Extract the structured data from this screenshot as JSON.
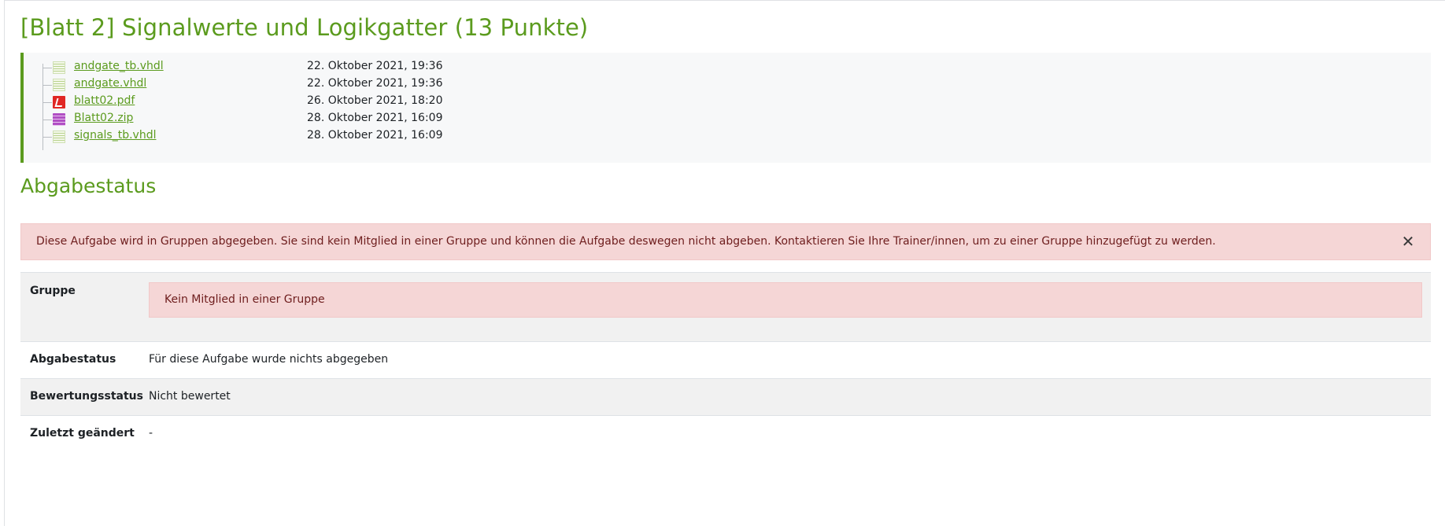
{
  "assignment": {
    "title": "[Blatt 2] Signalwerte und Logikgatter (13 Punkte)"
  },
  "files": [
    {
      "name": "andgate_tb.vhdl",
      "date": "22. Oktober 2021, 19:36",
      "icon": "text-file-icon"
    },
    {
      "name": "andgate.vhdl",
      "date": "22. Oktober 2021, 19:36",
      "icon": "text-file-icon"
    },
    {
      "name": "blatt02.pdf",
      "date": "26. Oktober 2021, 18:20",
      "icon": "pdf-file-icon"
    },
    {
      "name": "Blatt02.zip",
      "date": "28. Oktober 2021, 16:09",
      "icon": "zip-file-icon"
    },
    {
      "name": "signals_tb.vhdl",
      "date": "28. Oktober 2021, 16:09",
      "icon": "text-file-icon"
    }
  ],
  "submission_status": {
    "heading": "Abgabestatus",
    "alert": {
      "text": "Diese Aufgabe wird in Gruppen abgegeben. Sie sind kein Mitglied in einer Gruppe und können die Aufgabe deswegen nicht abgeben. Kontaktieren Sie Ihre Trainer/innen, um zu einer Gruppe hinzugefügt zu werden.",
      "close_icon": "close-icon",
      "close_symbol": "✕"
    },
    "rows": {
      "group": {
        "label": "Gruppe",
        "value": "Kein Mitglied in einer Gruppe"
      },
      "status": {
        "label": "Abgabestatus",
        "value": "Für diese Aufgabe wurde nichts abgegeben"
      },
      "grading": {
        "label": "Bewertungsstatus",
        "value": "Nicht bewertet"
      },
      "modified": {
        "label": "Zuletzt geändert",
        "value": "-"
      }
    }
  },
  "colors": {
    "accent": "#5b9b1e",
    "alert_bg": "#f5d6d6",
    "alert_text": "#6e1d1d",
    "files_bg": "#f7f8f9",
    "shaded_row": "#f1f1f1"
  }
}
